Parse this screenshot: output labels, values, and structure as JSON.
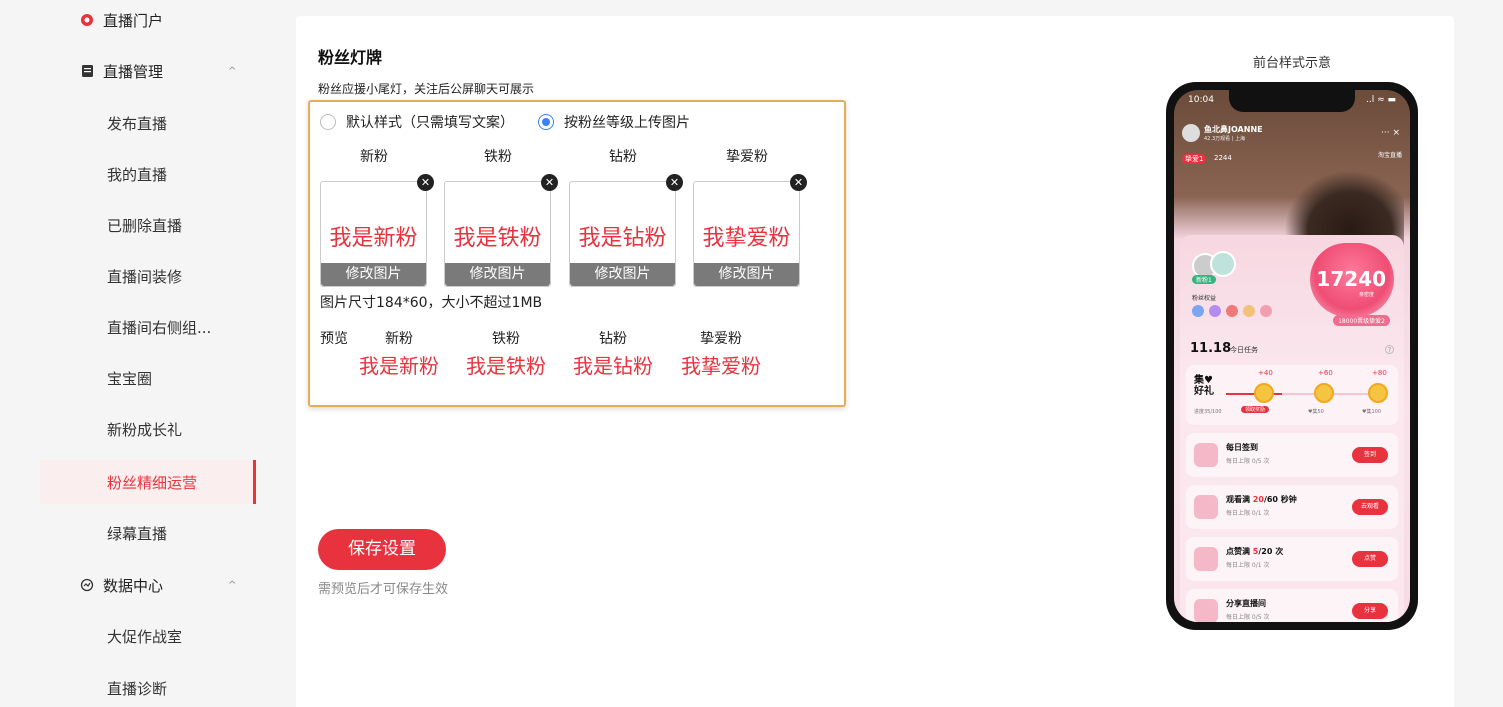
{
  "sidebar": {
    "portal": "直播门户",
    "manage": {
      "label": "直播管理",
      "chevron": "^"
    },
    "items": [
      "发布直播",
      "我的直播",
      "已删除直播",
      "直播间装修",
      "直播间右侧组...",
      "宝宝圈",
      "新粉成长礼",
      "粉丝精细运营",
      "绿幕直播"
    ],
    "data_center": {
      "label": "数据中心",
      "chevron": "^"
    },
    "data_items": [
      "大促作战室",
      "直播诊断"
    ]
  },
  "main": {
    "title": "粉丝灯牌",
    "subtitle": "粉丝应援小尾灯，关注后公屏聊天可展示",
    "style_options": {
      "default": "默认样式（只需填写文案）",
      "by_level": "按粉丝等级上传图片",
      "selected": "by_level"
    },
    "levels": [
      {
        "name": "新粉",
        "text": "我是新粉",
        "button": "修改图片"
      },
      {
        "name": "铁粉",
        "text": "我是铁粉",
        "button": "修改图片"
      },
      {
        "name": "钻粉",
        "text": "我是钻粉",
        "button": "修改图片"
      },
      {
        "name": "挚爱粉",
        "text": "我挚爱粉",
        "button": "修改图片"
      }
    ],
    "size_note": "图片尺寸184*60，大小不超过1MB",
    "preview": {
      "label": "预览",
      "items": [
        {
          "name": "新粉",
          "text": "我是新粉"
        },
        {
          "name": "铁粉",
          "text": "我是铁粉"
        },
        {
          "name": "钻粉",
          "text": "我是钻粉"
        },
        {
          "name": "挚爱粉",
          "text": "我挚爱粉"
        }
      ]
    },
    "save_button": "保存设置",
    "save_note": "需预览后才可保存生效",
    "phone_label": "前台样式示意"
  },
  "phone": {
    "time": "10:04",
    "status": "..l ≈ ▬",
    "host_name": "鱼北鼻JOANNE",
    "host_sub": "42.3万观看 | 上海",
    "controls": "···  ×",
    "badge": "挚爱1",
    "badge_count": "2244",
    "shop": "淘宝直播",
    "fan_tag": "新粉1",
    "fan_rights": "粉丝权益",
    "heart_value": "17240",
    "heart_sub": "亲密度",
    "heart_pill": "18000晋级挚爱2",
    "today": "11.18",
    "today_label": "今日任务",
    "help": "?",
    "collect": {
      "title": "集♥好礼",
      "plus": [
        "+40",
        "+60",
        "+80"
      ],
      "progress": "进度35/100",
      "claim": "领取奖励",
      "milestones": [
        "♥集50",
        "♥集100"
      ],
      "progress_fraction": 0.35
    },
    "tasks": [
      {
        "title": "每日签到",
        "highlight": "",
        "rest": "",
        "sub": "每日上限 0/5 次",
        "button": "签到"
      },
      {
        "title": "观看满 ",
        "highlight": "20",
        "rest": "/60 秒钟",
        "sub": "每日上限 0/1 次",
        "button": "去观看"
      },
      {
        "title": "点赞满 ",
        "highlight": "5",
        "rest": "/20 次",
        "sub": "每日上限 0/1 次",
        "button": "点赞"
      },
      {
        "title": "分享直播间",
        "highlight": "",
        "rest": "",
        "sub": "每日上限 0/5 次",
        "button": "分享"
      }
    ]
  },
  "colors": {
    "accent": "#e8333f",
    "highlight_border": "#e6ad55",
    "radio_selected": "#3b82f6"
  }
}
